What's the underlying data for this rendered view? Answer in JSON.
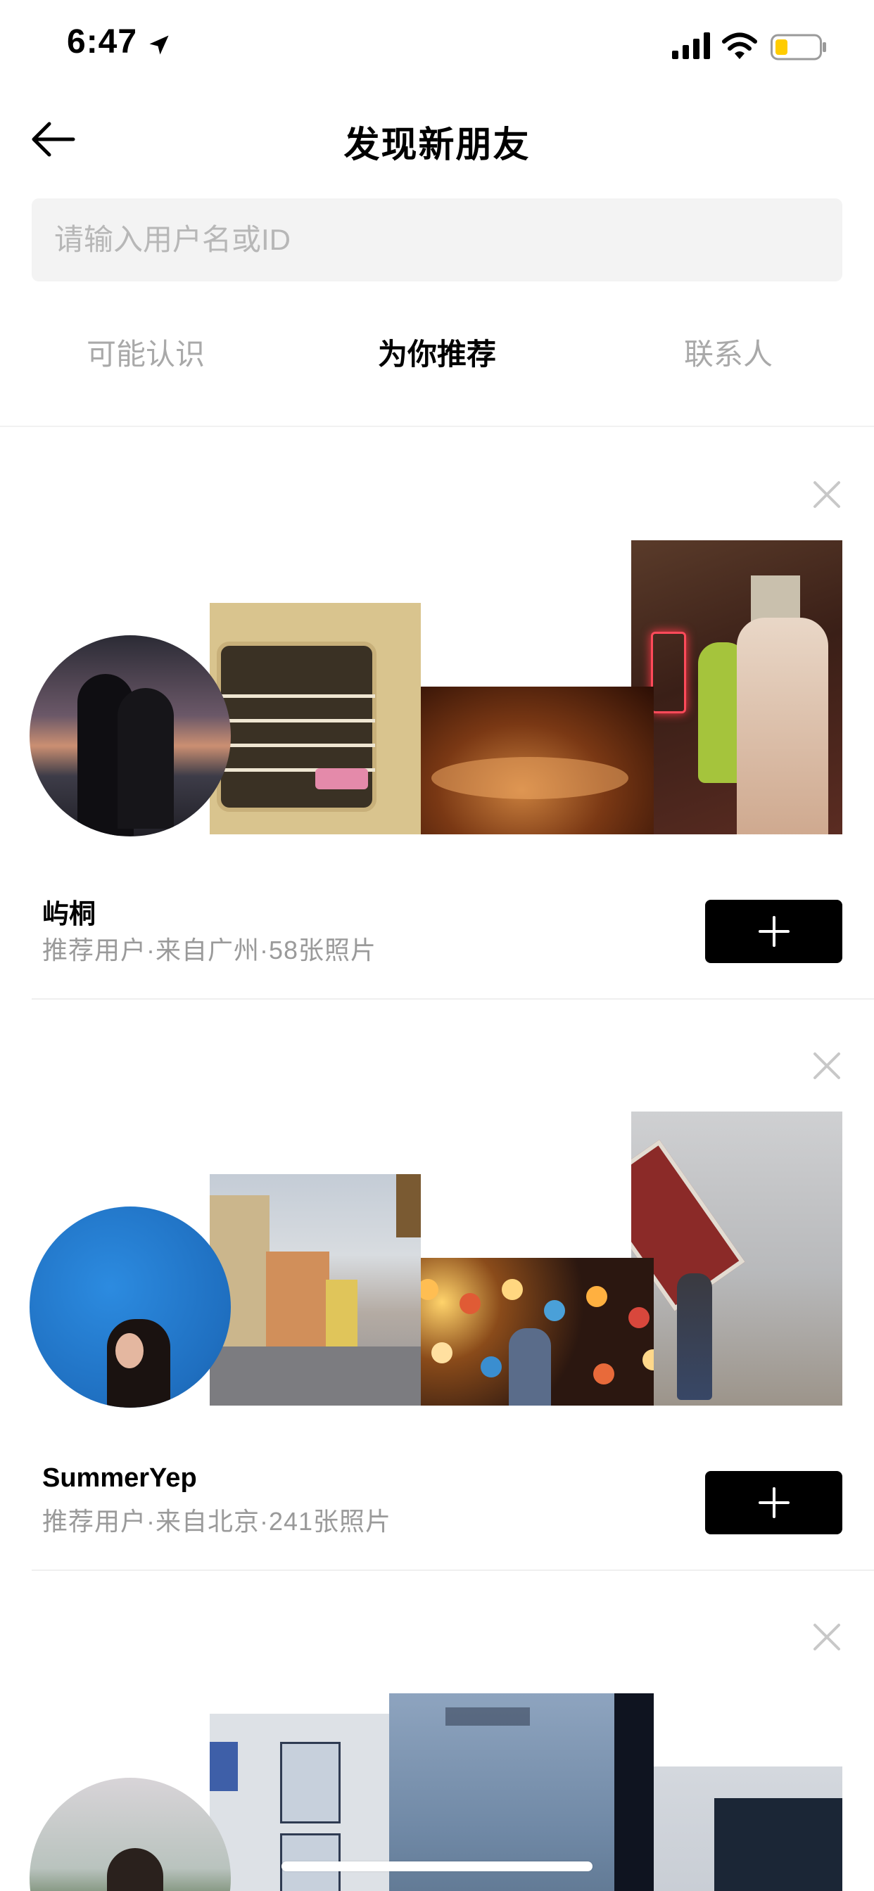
{
  "status_bar": {
    "time": "6:47",
    "battery_color": "#ffcc00"
  },
  "header": {
    "title": "发现新朋友",
    "back_icon": "arrow-left-icon"
  },
  "search": {
    "placeholder": "请输入用户名或ID",
    "value": ""
  },
  "tabs": [
    {
      "label": "可能认识",
      "active": false
    },
    {
      "label": "为你推荐",
      "active": true
    },
    {
      "label": "联系人",
      "active": false
    }
  ],
  "cards": [
    {
      "name": "屿桐",
      "meta": "推荐用户·来自广州·58张照片"
    },
    {
      "name": "SummerYep",
      "meta": "推荐用户·来自北京·241张照片"
    },
    {
      "name": "",
      "meta": ""
    }
  ]
}
